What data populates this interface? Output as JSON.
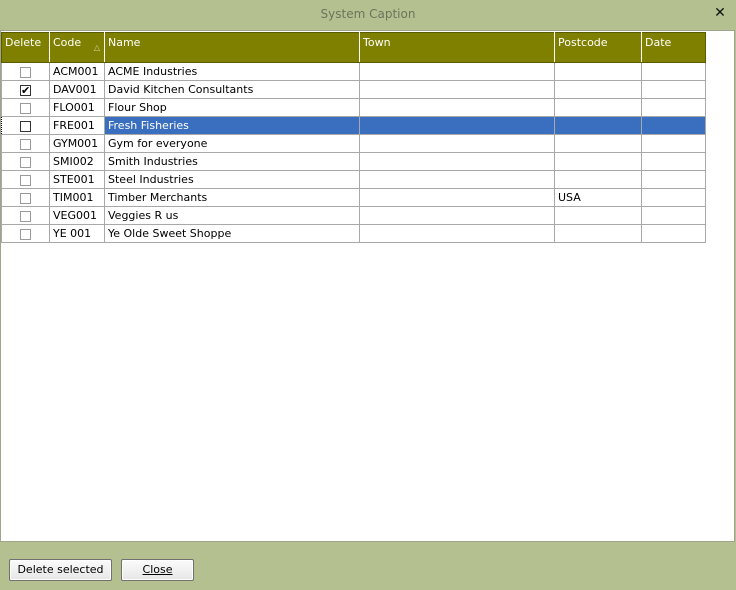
{
  "window": {
    "title": "System Caption",
    "close_glyph": "✕"
  },
  "grid": {
    "columns": [
      {
        "label": "Delete"
      },
      {
        "label": "Code",
        "sort": "ascending"
      },
      {
        "label": "Name"
      },
      {
        "label": "Town"
      },
      {
        "label": "Postcode"
      },
      {
        "label": "Date"
      }
    ],
    "sort_glyph": "△",
    "selected_row_index": 3,
    "rows": [
      {
        "delete": false,
        "code": "ACM001",
        "name": "ACME Industries",
        "town": "",
        "postcode": "",
        "date": ""
      },
      {
        "delete": true,
        "code": "DAV001",
        "name": "David Kitchen Consultants",
        "town": "",
        "postcode": "",
        "date": ""
      },
      {
        "delete": false,
        "code": "FLO001",
        "name": "Flour Shop",
        "town": "",
        "postcode": "",
        "date": ""
      },
      {
        "delete": true,
        "code": "FRE001",
        "name": "Fresh Fisheries",
        "town": "",
        "postcode": "",
        "date": ""
      },
      {
        "delete": false,
        "code": "GYM001",
        "name": "Gym for everyone",
        "town": "",
        "postcode": "",
        "date": ""
      },
      {
        "delete": false,
        "code": "SMI002",
        "name": "Smith Industries",
        "town": "",
        "postcode": "",
        "date": ""
      },
      {
        "delete": false,
        "code": "STE001",
        "name": "Steel Industries",
        "town": "",
        "postcode": "",
        "date": ""
      },
      {
        "delete": false,
        "code": "TIM001",
        "name": "Timber Merchants",
        "town": "",
        "postcode": "USA",
        "date": ""
      },
      {
        "delete": false,
        "code": "VEG001",
        "name": "Veggies R us",
        "town": "",
        "postcode": "",
        "date": ""
      },
      {
        "delete": false,
        "code": "YE 001",
        "name": "Ye Olde Sweet Shoppe",
        "town": "",
        "postcode": "",
        "date": ""
      }
    ]
  },
  "footer": {
    "delete_button_label": "Delete selected",
    "close_button_label": "Close"
  },
  "colors": {
    "window_background": "#b4c090",
    "header_background": "#808000",
    "selection_background": "#3a6ebe"
  }
}
